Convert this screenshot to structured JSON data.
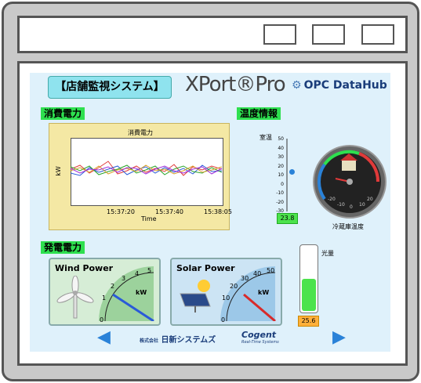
{
  "app": {
    "title": "【店舗監視システム】"
  },
  "logos": {
    "xport": "XPort®Pro",
    "opc": "OPC DataHub",
    "nisshin": "日新システムズ",
    "nisshin_prefix": "株式会社",
    "cogent": "Cogent",
    "cogent_sub": "Real-Time Systems"
  },
  "sections": {
    "consumption": "消費電力",
    "temperature": "温度情報",
    "generation": "発電電力"
  },
  "consumption_chart": {
    "title": "消費電力",
    "ylabel": "kW",
    "xlabel": "Time",
    "xticks": [
      "15:37:20",
      "15:37:40",
      "15:38:05"
    ]
  },
  "room_temp": {
    "label": "室温",
    "ticks": [
      "50",
      "40",
      "30",
      "20",
      "10",
      "0",
      "-10",
      "-20",
      "-30"
    ],
    "value": "23.8",
    "value_num": 23.8
  },
  "fridge": {
    "label": "冷蔵庫温度",
    "ticks": [
      "-20",
      "-10",
      "0",
      "10",
      "20"
    ]
  },
  "light": {
    "label": "光量",
    "value": "25.6",
    "level": 0.5
  },
  "wind": {
    "title": "Wind Power",
    "unit": "kW",
    "ticks": [
      "0",
      "1",
      "2",
      "3",
      "4",
      "5"
    ]
  },
  "solar": {
    "title": "Solar Power",
    "unit": "kW",
    "ticks": [
      "0",
      "10",
      "20",
      "30",
      "40",
      "50"
    ]
  },
  "colors": {
    "accent": "#2ee04f",
    "title_bg": "#8fe3ee",
    "chart_bg": "#f4e8a4"
  }
}
